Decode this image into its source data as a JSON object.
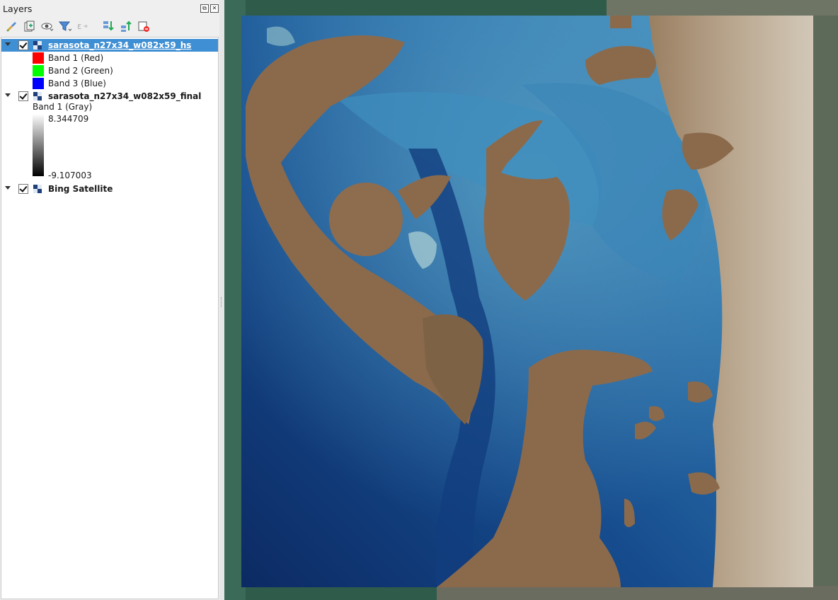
{
  "panel": {
    "title": "Layers",
    "title_buttons": [
      "⧉",
      "✕"
    ],
    "toolbar": [
      {
        "name": "style-brush-icon",
        "tip": ""
      },
      {
        "name": "add-group-icon",
        "tip": ""
      },
      {
        "name": "manage-visibility-icon",
        "tip": ""
      },
      {
        "name": "filter-legend-icon",
        "tip": ""
      },
      {
        "name": "filter-expression-icon",
        "tip": ""
      },
      {
        "name": "expand-all-icon",
        "tip": ""
      },
      {
        "name": "collapse-all-icon",
        "tip": ""
      },
      {
        "name": "remove-layer-icon",
        "tip": ""
      }
    ]
  },
  "layers": [
    {
      "name": "sarasota_n27x34_w082x59_hs",
      "checked": true,
      "selected": true,
      "bands": [
        {
          "label": "Band 1 (Red)",
          "color": "#ff0000"
        },
        {
          "label": "Band 2 (Green)",
          "color": "#00ff00"
        },
        {
          "label": "Band 3 (Blue)",
          "color": "#0000ff"
        }
      ]
    },
    {
      "name": "sarasota_n27x34_w082x59_final",
      "checked": true,
      "selected": false,
      "legend": {
        "label": "Band 1 (Gray)",
        "max": "8.344709",
        "min": "-9.107003"
      }
    },
    {
      "name": "Bing Satellite",
      "checked": true,
      "selected": false
    }
  ],
  "colors": {
    "selection": "#3f8fd4",
    "land": "#8b6a4c",
    "deep_water": "#0f2f6b",
    "shallow_water": "#3f8fbd",
    "upland": "#c4b6a2"
  }
}
